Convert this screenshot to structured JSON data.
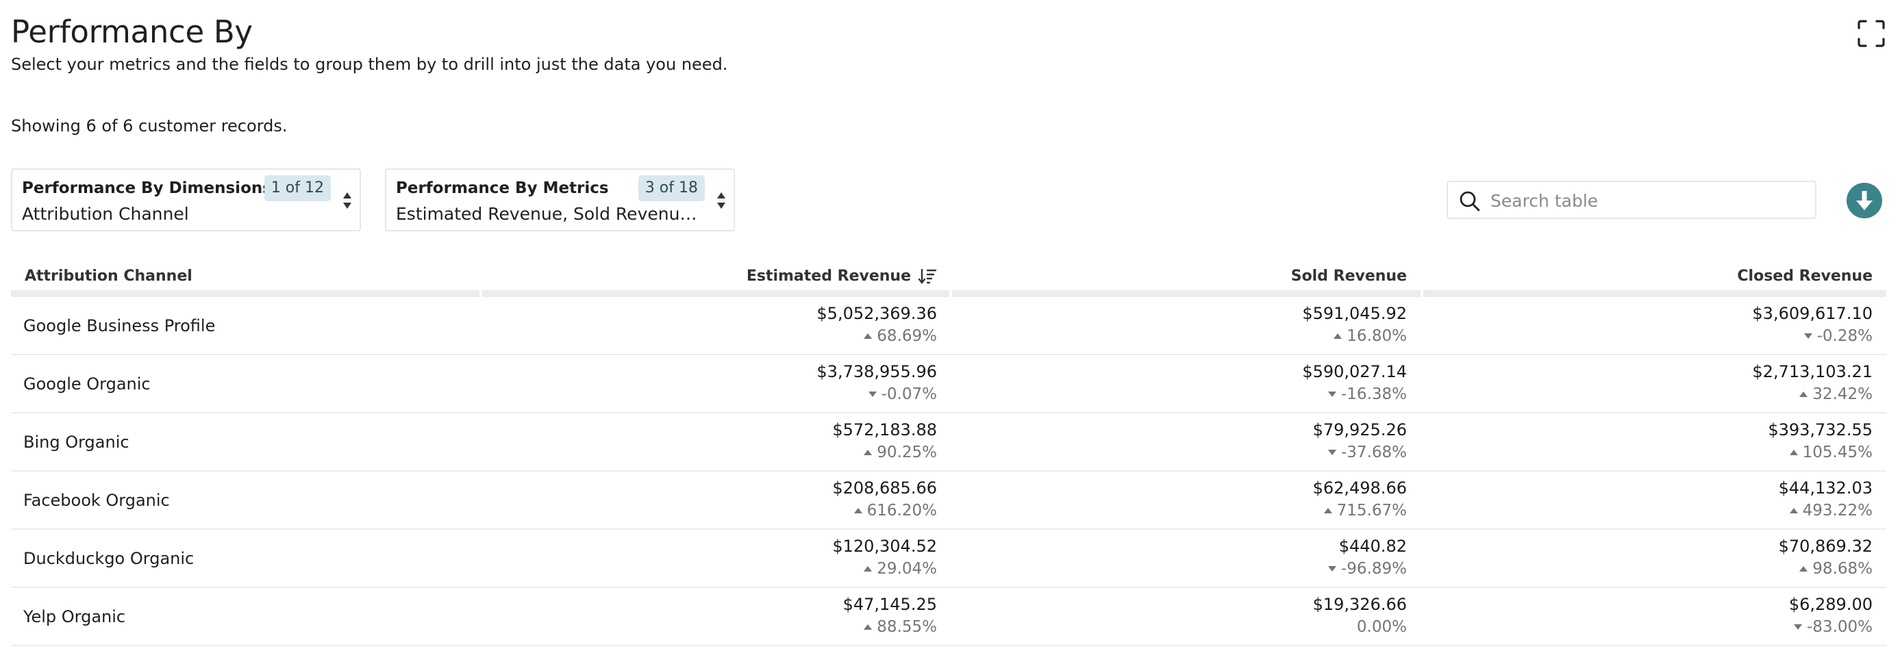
{
  "header": {
    "title": "Performance By",
    "subtitle": "Select your metrics and the fields to group them by to drill into just the data you need.",
    "records": "Showing 6 of 6 customer records."
  },
  "selectors": {
    "dimensions": {
      "label": "Performance By Dimensions",
      "badge": "1 of 12",
      "value": "Attribution Channel"
    },
    "metrics": {
      "label": "Performance By Metrics",
      "badge": "3 of 18",
      "value": "Estimated Revenue, Sold Revenue, C..."
    }
  },
  "search": {
    "placeholder": "Search table"
  },
  "icons": {
    "expand": "expand-icon",
    "search": "search-icon",
    "download": "download-icon",
    "sort": "sort-desc-icon",
    "up": "triangle-up-icon",
    "down": "triangle-down-icon"
  },
  "colors": {
    "accent": "#3b8489",
    "badge_bg": "#d8e8ee",
    "muted": "#757575"
  },
  "table": {
    "columns": [
      "Attribution Channel",
      "Estimated Revenue",
      "Sold Revenue",
      "Closed Revenue"
    ],
    "rows": [
      {
        "name": "Google Business Profile",
        "est": {
          "value": "$5,052,369.36",
          "change": "68.69%",
          "dir": "up"
        },
        "sold": {
          "value": "$591,045.92",
          "change": "16.80%",
          "dir": "up"
        },
        "closed": {
          "value": "$3,609,617.10",
          "change": "-0.28%",
          "dir": "down"
        }
      },
      {
        "name": "Google Organic",
        "est": {
          "value": "$3,738,955.96",
          "change": "-0.07%",
          "dir": "down"
        },
        "sold": {
          "value": "$590,027.14",
          "change": "-16.38%",
          "dir": "down"
        },
        "closed": {
          "value": "$2,713,103.21",
          "change": "32.42%",
          "dir": "up"
        }
      },
      {
        "name": "Bing Organic",
        "est": {
          "value": "$572,183.88",
          "change": "90.25%",
          "dir": "up"
        },
        "sold": {
          "value": "$79,925.26",
          "change": "-37.68%",
          "dir": "down"
        },
        "closed": {
          "value": "$393,732.55",
          "change": "105.45%",
          "dir": "up"
        }
      },
      {
        "name": "Facebook Organic",
        "est": {
          "value": "$208,685.66",
          "change": "616.20%",
          "dir": "up"
        },
        "sold": {
          "value": "$62,498.66",
          "change": "715.67%",
          "dir": "up"
        },
        "closed": {
          "value": "$44,132.03",
          "change": "493.22%",
          "dir": "up"
        }
      },
      {
        "name": "Duckduckgo Organic",
        "est": {
          "value": "$120,304.52",
          "change": "29.04%",
          "dir": "up"
        },
        "sold": {
          "value": "$440.82",
          "change": "-96.89%",
          "dir": "down"
        },
        "closed": {
          "value": "$70,869.32",
          "change": "98.68%",
          "dir": "up"
        }
      },
      {
        "name": "Yelp Organic",
        "est": {
          "value": "$47,145.25",
          "change": "88.55%",
          "dir": "up"
        },
        "sold": {
          "value": "$19,326.66",
          "change": "0.00%",
          "dir": "none"
        },
        "closed": {
          "value": "$6,289.00",
          "change": "-83.00%",
          "dir": "down"
        }
      }
    ]
  }
}
